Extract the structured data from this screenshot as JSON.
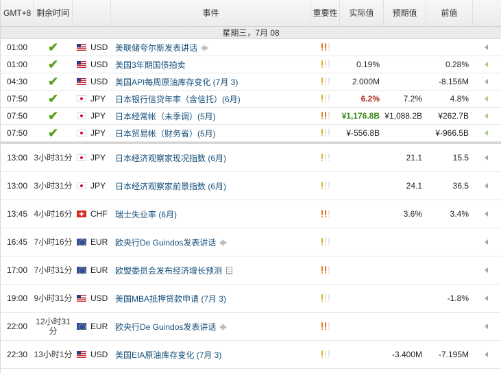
{
  "header": {
    "timezone": "GMT+8",
    "remaining": "剩余时间",
    "event": "事件",
    "importance": "重要性",
    "actual": "实际值",
    "forecast": "预期值",
    "previous": "前值"
  },
  "day_label": "星期三，7月 08",
  "colors": {
    "importance_high": "#e07a1f",
    "importance_medium": "#d9b41a",
    "importance_low": "#e2e2e2",
    "actual_worse": "#b32f21",
    "actual_better": "#3b8c1e",
    "check": "#5aa01e",
    "event_link": "#134e7a"
  },
  "released": [
    {
      "time": "01:00",
      "done": true,
      "flag": "us",
      "currency": "USD",
      "event": "美联储夸尔斯发表讲话",
      "icon": "speech-icon",
      "importance": "high",
      "actual": "",
      "actual_style": "",
      "forecast": "",
      "previous": "",
      "arrow": "gray"
    },
    {
      "time": "01:00",
      "done": true,
      "flag": "us",
      "currency": "USD",
      "event": "美国3年期国债拍卖",
      "icon": "",
      "importance": "medium",
      "actual": "0.19%",
      "actual_style": "",
      "forecast": "",
      "previous": "0.28%",
      "arrow": "green"
    },
    {
      "time": "04:30",
      "done": true,
      "flag": "us",
      "currency": "USD",
      "event": "美国API每周原油库存变化 (7月 3)",
      "icon": "",
      "importance": "medium",
      "actual": "2.000M",
      "actual_style": "",
      "forecast": "",
      "previous": "-8.156M",
      "arrow": "gray"
    },
    {
      "time": "07:50",
      "done": true,
      "flag": "jp",
      "currency": "JPY",
      "event": "日本银行信贷年率（含信托）(6月)",
      "icon": "",
      "importance": "medium",
      "actual": "6.2%",
      "actual_style": "red",
      "forecast": "7.2%",
      "previous": "4.8%",
      "arrow": "green"
    },
    {
      "time": "07:50",
      "done": true,
      "flag": "jp",
      "currency": "JPY",
      "event": "日本经常帐（未季调）(5月)",
      "icon": "",
      "importance": "high",
      "actual": "¥1,176.8B",
      "actual_style": "green",
      "forecast": "¥1,088.2B",
      "previous": "¥262.7B",
      "arrow": "green"
    },
    {
      "time": "07:50",
      "done": true,
      "flag": "jp",
      "currency": "JPY",
      "event": "日本贸易帐（财务省）(5月)",
      "icon": "",
      "importance": "medium",
      "actual": "¥-556.8B",
      "actual_style": "",
      "forecast": "",
      "previous": "¥-966.5B",
      "arrow": "green"
    }
  ],
  "upcoming": [
    {
      "time": "13:00",
      "remaining": "3小时31分",
      "flag": "jp",
      "currency": "JPY",
      "event": "日本经济观察家现况指数 (6月)",
      "icon": "",
      "importance": "medium",
      "actual": "",
      "forecast": "21.1",
      "previous": "15.5",
      "arrow": "gray"
    },
    {
      "time": "13:00",
      "remaining": "3小时31分",
      "flag": "jp",
      "currency": "JPY",
      "event": "日本经济观察家前景指数 (6月)",
      "icon": "",
      "importance": "medium",
      "actual": "",
      "forecast": "24.1",
      "previous": "36.5",
      "arrow": "gray"
    },
    {
      "time": "13:45",
      "remaining": "4小时16分",
      "flag": "ch",
      "currency": "CHF",
      "event": "瑞士失业率 (6月)",
      "icon": "",
      "importance": "high",
      "actual": "",
      "forecast": "3.6%",
      "previous": "3.4%",
      "arrow": "gray"
    },
    {
      "time": "16:45",
      "remaining": "7小时16分",
      "flag": "eu",
      "currency": "EUR",
      "event": "欧央行De Guindos发表讲话",
      "icon": "speech-icon",
      "importance": "medium",
      "actual": "",
      "forecast": "",
      "previous": "",
      "arrow": "gray"
    },
    {
      "time": "17:00",
      "remaining": "7小时31分",
      "flag": "eu",
      "currency": "EUR",
      "event": "欧盟委员会发布经济增长预测",
      "icon": "doc-icon",
      "importance": "high",
      "actual": "",
      "forecast": "",
      "previous": "",
      "arrow": "gray"
    },
    {
      "time": "19:00",
      "remaining": "9小时31分",
      "flag": "us",
      "currency": "USD",
      "event": "美国MBA抵押贷款申请 (7月 3)",
      "icon": "",
      "importance": "medium",
      "actual": "",
      "forecast": "",
      "previous": "-1.8%",
      "arrow": "gray"
    },
    {
      "time": "22:00",
      "remaining": "12小时31分",
      "flag": "eu",
      "currency": "EUR",
      "event": "欧央行De Guindos发表讲话",
      "icon": "speech-icon",
      "importance": "high",
      "actual": "",
      "forecast": "",
      "previous": "",
      "arrow": "gray"
    },
    {
      "time": "22:30",
      "remaining": "13小时1分",
      "flag": "us",
      "currency": "USD",
      "event": "美国EIA原油库存变化 (7月 3)",
      "icon": "",
      "importance": "medium",
      "actual": "",
      "forecast": "-3.400M",
      "previous": "-7.195M",
      "arrow": "gray"
    }
  ]
}
